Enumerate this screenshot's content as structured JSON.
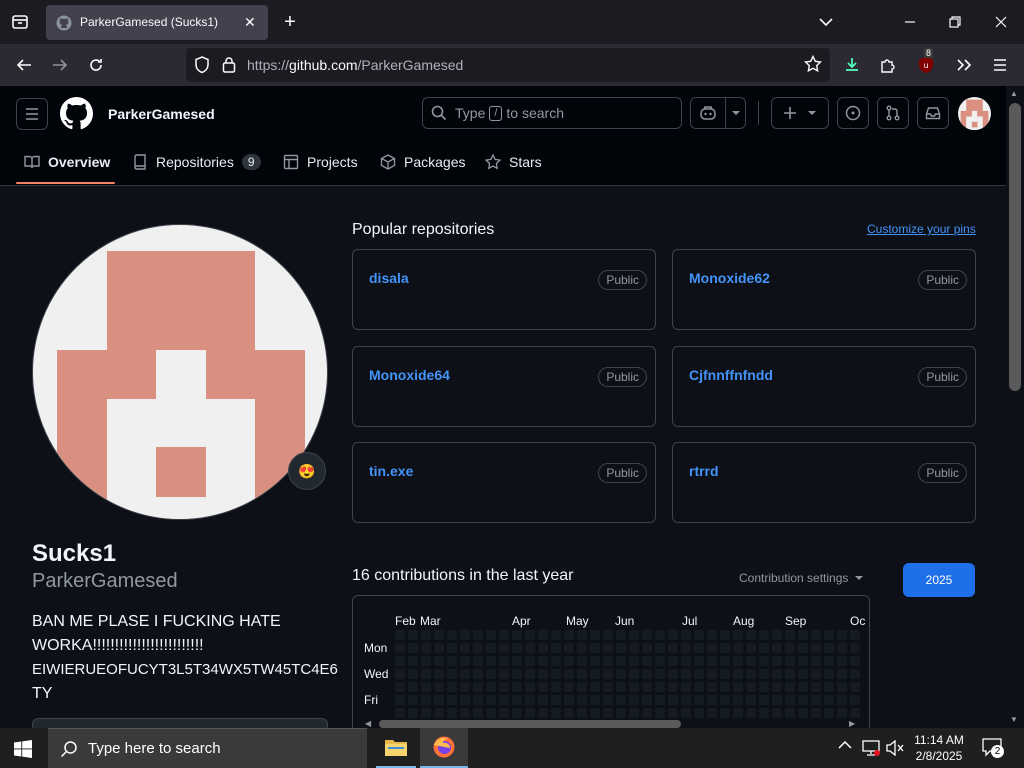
{
  "browser": {
    "tab_title": "ParkerGamesed (Sucks1)",
    "url_prefix": "https://",
    "url_host": "github.com",
    "url_path": "/ParkerGamesed",
    "ext_badge": "8"
  },
  "header": {
    "username": "ParkerGamesed",
    "search_prefix": "Type",
    "search_key": "/",
    "search_suffix": "to search"
  },
  "nav": {
    "tabs": [
      {
        "label": "Overview"
      },
      {
        "label": "Repositories",
        "count": "9"
      },
      {
        "label": "Projects"
      },
      {
        "label": "Packages"
      },
      {
        "label": "Stars"
      }
    ]
  },
  "profile": {
    "status_emoji": "😍",
    "name": "Sucks1",
    "login": "ParkerGamesed",
    "bio_line1": "BAN ME PLASE I FUCKING HATE",
    "bio_line2": "WORKA!!!!!!!!!!!!!!!!!!!!!!!!!",
    "bio_line3": "EIWIERUEOFUCYT3L5T34WX5TW45TC4E6",
    "bio_line4": "TY"
  },
  "pinned": {
    "title": "Popular repositories",
    "customize": "Customize your pins",
    "repos": [
      {
        "name": "disala",
        "badge": "Public"
      },
      {
        "name": "Monoxide62",
        "badge": "Public"
      },
      {
        "name": "Monoxide64",
        "badge": "Public"
      },
      {
        "name": "Cjfnnffnfndd",
        "badge": "Public"
      },
      {
        "name": "tin.exe",
        "badge": "Public"
      },
      {
        "name": "rtrrd",
        "badge": "Public"
      }
    ]
  },
  "contrib": {
    "title": "16 contributions in the last year",
    "settings": "Contribution settings",
    "year": "2025",
    "months": [
      "Feb",
      "Mar",
      "Apr",
      "May",
      "Jun",
      "Jul",
      "Aug",
      "Sep",
      "Oc"
    ],
    "days": [
      "Mon",
      "Wed",
      "Fri"
    ]
  },
  "taskbar": {
    "search_placeholder": "Type here to search",
    "time": "11:14 AM",
    "date": "2/8/2025",
    "notif_count": "2"
  },
  "colors": {
    "accent_link": "#4493f8",
    "avatar_salmon": "#d99080",
    "year_button": "#1f6feb",
    "tab_underline": "#f78166"
  }
}
